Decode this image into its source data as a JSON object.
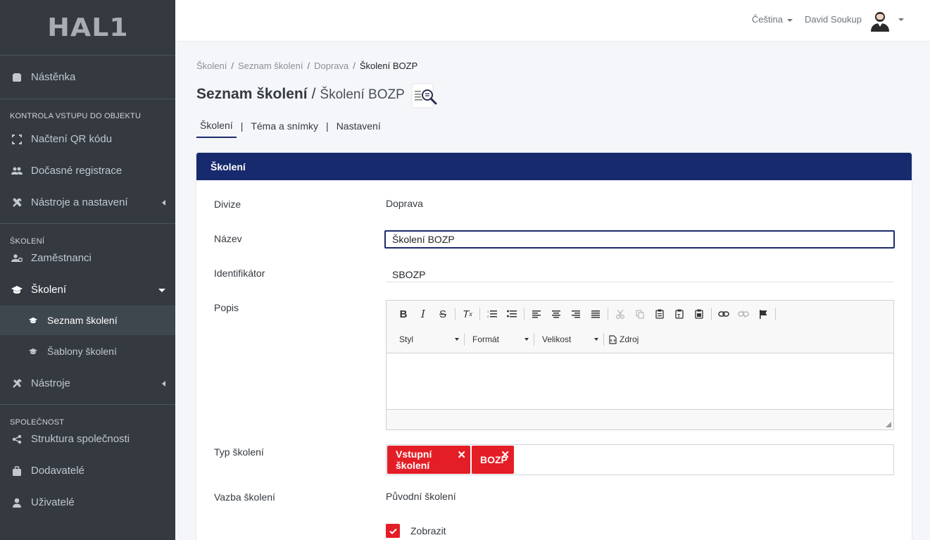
{
  "brand": "HAL1",
  "sidebar": {
    "items": [
      {
        "label": "Nástěnka",
        "icon": "dashboard-icon"
      },
      {
        "header": "KONTROLA VSTUPU DO OBJEKTU"
      },
      {
        "label": "Načtení QR kódu",
        "icon": "qr-scan-icon"
      },
      {
        "label": "Dočasné registrace",
        "icon": "users-icon"
      },
      {
        "label": "Nástroje a nastavení",
        "icon": "tools-icon"
      },
      {
        "header": "ŠKOLENÍ"
      },
      {
        "label": "Zaměstnanci",
        "icon": "employees-icon"
      },
      {
        "label": "Školení",
        "icon": "graduation-cap-icon"
      },
      {
        "label": "Seznam školení",
        "icon": "graduation-cap-small-icon"
      },
      {
        "label": "Šablony školení",
        "icon": "graduation-cap-small-icon"
      },
      {
        "label": "Nástroje",
        "icon": "tools-icon"
      },
      {
        "header": "SPOLEČNOST"
      },
      {
        "label": "Struktura společnosti",
        "icon": "share-icon"
      },
      {
        "label": "Dodavatelé",
        "icon": "briefcase-icon"
      },
      {
        "label": "Uživatelé",
        "icon": "user-icon"
      }
    ]
  },
  "topbar": {
    "language": "Čeština",
    "user_name": "David Soukup"
  },
  "breadcrumb": [
    "Školení",
    "Seznam školení",
    "Doprava",
    "Školení BOZP"
  ],
  "page": {
    "title": "Seznam školení",
    "subtitle": "Školení BOZP"
  },
  "tabs": [
    "Školení",
    "Téma a snímky",
    "Nastavení"
  ],
  "card": {
    "header": "Školení",
    "fields": {
      "divize_label": "Divize",
      "divize_value": "Doprava",
      "nazev_label": "Název",
      "nazev_value": "Školení BOZP",
      "identifikator_label": "Identifikátor",
      "identifikator_value": "SBOZP",
      "popis_label": "Popis",
      "typ_label": "Typ školení",
      "tags": [
        "Vstupní školení",
        "BOZP"
      ],
      "vazba_label": "Vazba školení",
      "vazba_value": "Původní školení",
      "zobrazit_label": "Zobrazit",
      "zobrazit_checked": true
    },
    "editor": {
      "combo_styl": "Styl",
      "combo_format": "Formát",
      "combo_velikost": "Velikost",
      "source_label": "Zdroj"
    }
  },
  "colors": {
    "sidebar_bg": "#343a40",
    "card_header": "#172a6e",
    "tag_red": "#e41e26"
  }
}
